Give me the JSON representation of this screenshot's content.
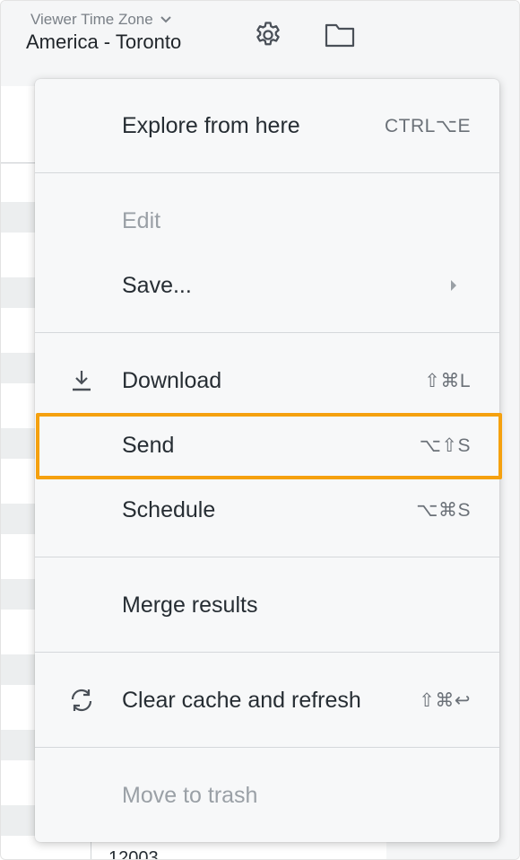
{
  "header": {
    "timezone_label": "Viewer Time Zone",
    "timezone_value": "America - Toronto"
  },
  "background": {
    "peek_text": "12003"
  },
  "menu": {
    "items": [
      {
        "label": "Explore from here",
        "shortcut": "CTRL⌥E"
      },
      {
        "label": "Edit"
      },
      {
        "label": "Save..."
      },
      {
        "label": "Download",
        "shortcut": "⇧⌘L",
        "icon": "download-icon"
      },
      {
        "label": "Send",
        "shortcut": "⌥⇧S"
      },
      {
        "label": "Schedule",
        "shortcut": "⌥⌘S"
      },
      {
        "label": "Merge results"
      },
      {
        "label": "Clear cache and refresh",
        "shortcut": "⇧⌘↩",
        "icon": "refresh-icon"
      },
      {
        "label": "Move to trash"
      }
    ]
  },
  "colors": {
    "highlight": "#f5a10f",
    "menu_background": "#f7f8f9",
    "disabled_text": "#9aa0a6"
  }
}
